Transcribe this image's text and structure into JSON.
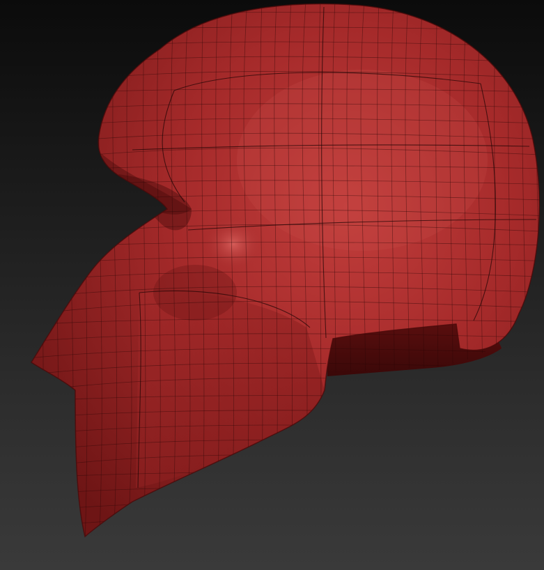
{
  "viewport": {
    "background_top": "#0b0b0b",
    "background_bottom": "#3a3a3a"
  },
  "model": {
    "name": "",
    "material_color": "#a52a2a",
    "material_highlight": "#c94a48",
    "material_shadow": "#5a1010",
    "wire_color": "#2a0606",
    "show_polyframe": true
  }
}
